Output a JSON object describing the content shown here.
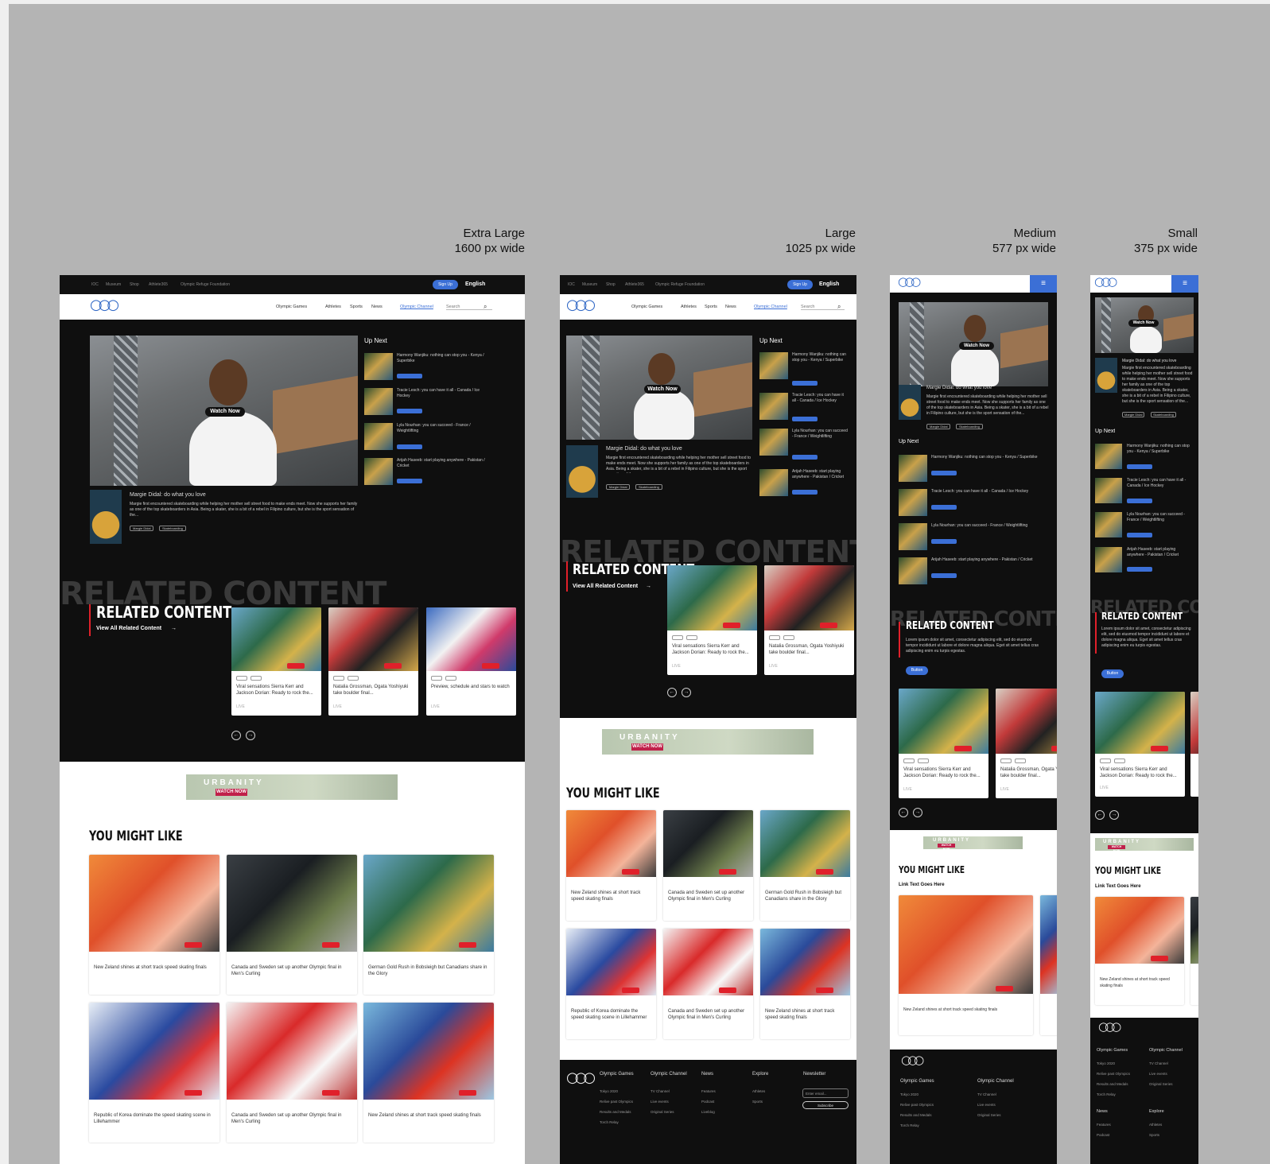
{
  "captions": [
    {
      "line1": "Extra Large",
      "line2": "1600 px wide"
    },
    {
      "line1": "Large",
      "line2": "1025 px wide"
    },
    {
      "line1": "Medium",
      "line2": "577 px wide"
    },
    {
      "line1": "Small",
      "line2": "375 px wide"
    }
  ],
  "utility_nav": [
    "IOC",
    "Museum",
    "Shop",
    "Athlete365",
    "Olympic Refuge Foundation"
  ],
  "utility_actions": {
    "signup": "Sign Up",
    "language": "English"
  },
  "main_nav": [
    "Olympic Games",
    "Athletes",
    "Sports",
    "News",
    "Olympic Channel"
  ],
  "search_placeholder": "Search",
  "hero": {
    "watch": "Watch Now",
    "title": "Margie Didal: do what you love",
    "desc": "Margie first encountered skateboarding while helping her mother sell street food to make ends meet. Now she supports her family as one of the top skateboarders in Asia. Being a skater, she is a bit of a rebel in Filipino culture, but she is the sport sensation of the...",
    "tags": [
      "Margie Didal",
      "Skateboarding"
    ]
  },
  "up_next": {
    "title": "Up Next",
    "items": [
      "Harmony Wanjiku: nothing can stop you - Kenya / Superbike",
      "Tracie Lesch: you can have it all - Canada / Ice Hockey",
      "Lyla Nourhan: you can succeed - France / Weightlifting",
      "Arijah Haseeb: start playing anywhere - Pakistan / Cricket"
    ],
    "desc_label": "Description",
    "badge": "Highlights",
    "time": "40:00"
  },
  "related": {
    "title": "RELATED CONTENT",
    "link": "View All Related Content",
    "body": "Lorem ipsum dolor sit amet, consectetur adipiscing elit, sed do eiusmod tempor incididunt ut labore et dolore magna aliqua. Eget sit amet tellus cras adipiscing enim eu turpis egestas.",
    "button": "Button",
    "cards": [
      "Viral sensations Sierra Kerr and Jackson Dorian: Ready to rock the...",
      "Natalia Grossman, Ogata Yoshiyuki take boulder final...",
      "Preview, schedule and stars to watch"
    ],
    "live": "LIVE"
  },
  "banner": {
    "brand": "URBANITY",
    "cta": "WATCH NOW"
  },
  "might_like": {
    "title": "YOU MIGHT LIKE",
    "link": "Link Text Goes Here",
    "cards": [
      "New Zeland shines at short track speed skating finals",
      "Canada and Sweden set up another Olympic final in Men's Curling",
      "German Gold Rush in Bobsleigh but Canadians share in the Glory",
      "Republic of Korea dominate the speed skating scene in Lillehammer",
      "Canada and Sweden set up another Olympic final in Men's Curling",
      "New Zeland shines at short track speed skating finals"
    ],
    "tag1": "Tag 1",
    "tag2": "Tag 2"
  },
  "footer": {
    "cols": [
      {
        "title": "Olympic Games",
        "items": [
          "Tokyo 2020",
          "Relive past Olympics",
          "Results and Medals",
          "Torch Relay"
        ]
      },
      {
        "title": "Olympic Channel",
        "items": [
          "TV Channel",
          "Live events",
          "Original Series"
        ]
      },
      {
        "title": "News",
        "items": [
          "Features",
          "Podcast",
          "Liveblog"
        ]
      },
      {
        "title": "Explore",
        "items": [
          "Athletes",
          "Sports"
        ]
      }
    ],
    "newsletter": {
      "title": "Newsletter",
      "placeholder": "Enter email...",
      "button": "Subscribe"
    }
  },
  "colors": {
    "accent": "#3b6fd6",
    "live": "#e0202a",
    "dark": "#0f0f0f",
    "canvas": "#b4b4b4"
  }
}
